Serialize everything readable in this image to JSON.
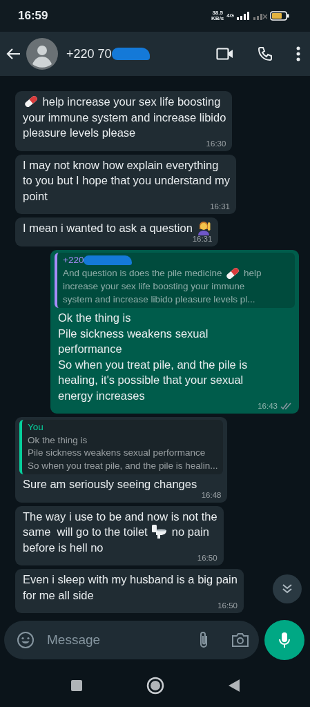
{
  "status_bar": {
    "time": "16:59",
    "speed": "38.5",
    "speed_unit": "KB/s",
    "network": "4G"
  },
  "header": {
    "contact": "+220 70",
    "redacted": true
  },
  "messages": [
    {
      "outgoing": false,
      "lines": [
        [
          {
            "kind": "pill"
          },
          {
            "kind": "text",
            "text": " help increase your sex life boosting"
          }
        ],
        [
          {
            "kind": "text",
            "text": "your immune system and increase libido"
          }
        ],
        [
          {
            "kind": "text",
            "text": "pleasure levels please"
          }
        ]
      ],
      "time": "16:30"
    },
    {
      "outgoing": false,
      "lines": [
        [
          {
            "kind": "text",
            "text": "I may not know how explain everything"
          }
        ],
        [
          {
            "kind": "text",
            "text": "to you but I hope that you understand my"
          }
        ],
        [
          {
            "kind": "text",
            "text": "point"
          }
        ]
      ],
      "time": "16:31"
    },
    {
      "outgoing": false,
      "lines": [
        [
          {
            "kind": "text",
            "text": "I mean i wanted to ask a question "
          },
          {
            "kind": "raised-hand"
          }
        ]
      ],
      "time": "16:31"
    },
    {
      "outgoing": true,
      "quote": {
        "author": "+220",
        "redacted": true,
        "color": "#a78bfa",
        "lines": [
          [
            {
              "kind": "text",
              "text": "And question is does the pile medicine "
            },
            {
              "kind": "pill"
            },
            {
              "kind": "text",
              "text": " help"
            }
          ],
          [
            {
              "kind": "text",
              "text": "increase your sex life boosting your immune"
            }
          ],
          [
            {
              "kind": "text",
              "text": "system and increase libido pleasure levels pl..."
            }
          ]
        ]
      },
      "lines": [
        [
          {
            "kind": "text",
            "text": "Ok the thing is"
          }
        ],
        [
          {
            "kind": "text",
            "text": "Pile sickness weakens sexual"
          }
        ],
        [
          {
            "kind": "text",
            "text": "performance"
          }
        ],
        [
          {
            "kind": "text",
            "text": "So when you treat pile, and the pile is"
          }
        ],
        [
          {
            "kind": "text",
            "text": "healing, it's possible that your sexual"
          }
        ],
        [
          {
            "kind": "text",
            "text": "energy increases"
          }
        ]
      ],
      "time": "16:43",
      "read": false
    },
    {
      "outgoing": false,
      "quote": {
        "author": "You",
        "redacted": false,
        "color": "#06cf9c",
        "lines": [
          [
            {
              "kind": "text",
              "text": "Ok the thing is"
            }
          ],
          [
            {
              "kind": "text",
              "text": "Pile sickness weakens sexual performance"
            }
          ],
          [
            {
              "kind": "text",
              "text": "So when you treat pile, and the pile is healin..."
            }
          ]
        ]
      },
      "lines": [
        [
          {
            "kind": "text",
            "text": "Sure am seriously seeing changes"
          }
        ]
      ],
      "time": "16:48"
    },
    {
      "outgoing": false,
      "lines": [
        [
          {
            "kind": "text",
            "text": "The way i use to be and now is not the"
          }
        ],
        [
          {
            "kind": "text",
            "text": "same  will go to the toilet "
          },
          {
            "kind": "toilet"
          },
          {
            "kind": "text",
            "text": " no pain"
          }
        ],
        [
          {
            "kind": "text",
            "text": "before is hell no"
          }
        ]
      ],
      "time": "16:50"
    },
    {
      "outgoing": false,
      "lines": [
        [
          {
            "kind": "text",
            "text": "Even i sleep with my husband is a big pain"
          }
        ],
        [
          {
            "kind": "text",
            "text": "for me all side"
          }
        ]
      ],
      "time": "16:50"
    }
  ],
  "composer": {
    "placeholder": "Message"
  }
}
